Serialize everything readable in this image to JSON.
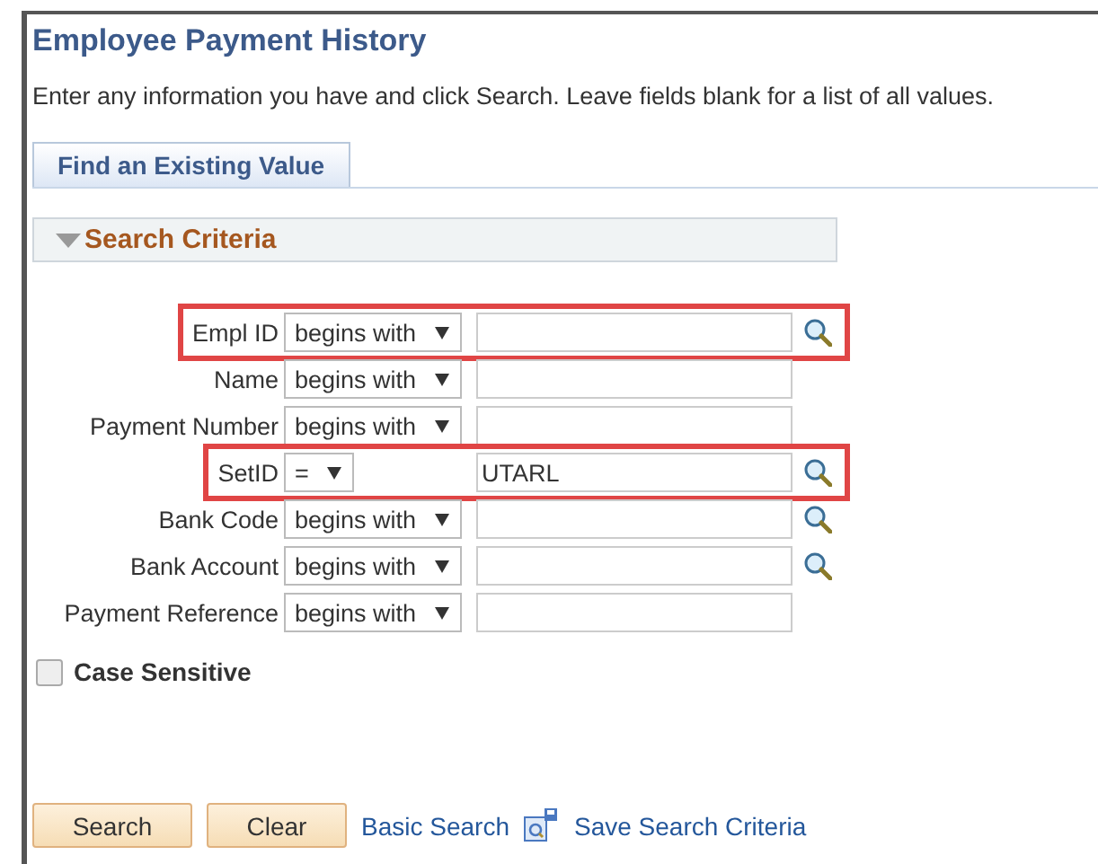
{
  "page": {
    "title": "Employee Payment History",
    "instructions": "Enter any information you have and click Search. Leave fields blank for a list of all values."
  },
  "tabs": [
    {
      "label": "Find an Existing Value",
      "selected": true
    }
  ],
  "section": {
    "title": "Search Criteria",
    "expanded": true
  },
  "fields": [
    {
      "label": "Empl ID",
      "operator": "begins with",
      "lookup": true,
      "highlighted": true
    },
    {
      "label": "Name",
      "operator": "begins with",
      "lookup": false,
      "highlighted": false
    },
    {
      "label": "Payment Number",
      "operator": "begins with",
      "lookup": false,
      "highlighted": false
    },
    {
      "label": "SetID",
      "operator": "=",
      "value": "UTARL",
      "lookup": true,
      "highlighted": true
    },
    {
      "label": "Bank Code",
      "operator": "begins with",
      "lookup": true,
      "highlighted": false
    },
    {
      "label": "Bank Account",
      "operator": "begins with",
      "lookup": true,
      "highlighted": false
    },
    {
      "label": "Payment Reference",
      "operator": "begins with",
      "lookup": false,
      "highlighted": false
    }
  ],
  "case_sensitive": {
    "label": "Case Sensitive",
    "checked": false
  },
  "buttons": [
    {
      "label": "Search"
    },
    {
      "label": "Clear"
    }
  ],
  "links": [
    {
      "label": "Basic Search"
    },
    {
      "label": "Save Search Criteria"
    }
  ]
}
